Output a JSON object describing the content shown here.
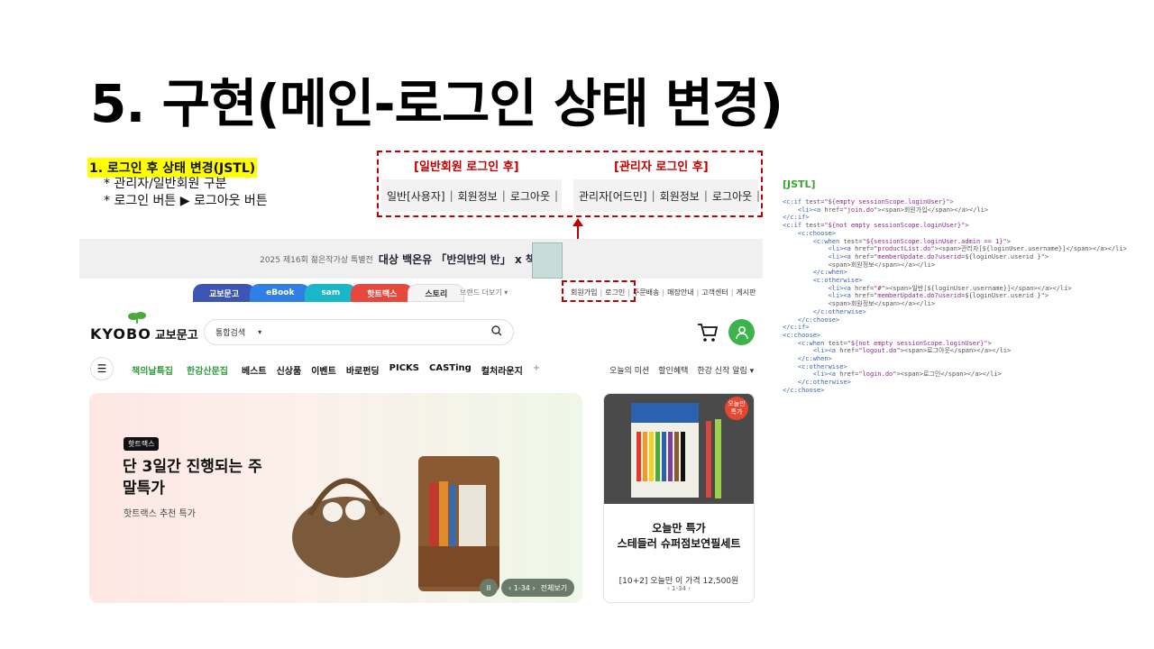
{
  "slide": {
    "title": "5. 구현(메인-로그인 상태 변경)",
    "step": "1. 로그인 후 상태 변경(JSTL)",
    "bullets": [
      "* 관리자/일반회원 구분",
      "* 로그인 버튼 ▶ 로그아웃 버튼"
    ]
  },
  "states": {
    "user_label": "[일반회원 로그인 후]",
    "admin_label": "[관리자 로그인 후]",
    "user_items": [
      "일반[사용자]",
      "회원정보",
      "로그아웃"
    ],
    "admin_items": [
      "관리자[어드민]",
      "회원정보",
      "로그아웃"
    ],
    "separator": "|"
  },
  "kyobo": {
    "banner": {
      "small": "2025 제16회 젊은작가상 특별전",
      "bold": "대상 백온유 「반의반의 반」 x 책갈피"
    },
    "tabs": [
      {
        "label": "교보문고",
        "color": "#3d55b4"
      },
      {
        "label": "eBook",
        "color": "#2f7fe6"
      },
      {
        "label": "sam",
        "color": "#19b8c8"
      },
      {
        "label": "핫트랙스",
        "color": "#e8483b"
      },
      {
        "label": "스토리",
        "color": "#f4f4f4"
      }
    ],
    "brand_more": "브랜드 더보기 ▾",
    "util_nav": [
      "회원가입",
      "로그인",
      "주문배송",
      "매장안내",
      "고객센터",
      "게시판"
    ],
    "logo_word": "KYOBO",
    "logo_kr": "교보문고",
    "search": {
      "category": "통합검색",
      "dropdown": "▾",
      "icon": "search-icon"
    },
    "gnb": [
      {
        "label": "책의날특집",
        "color": "#2e9b3a",
        "dot": true
      },
      {
        "label": "한강산문집",
        "color": "#2e9b3a",
        "dot": true
      },
      {
        "label": "베스트",
        "color": "#111"
      },
      {
        "label": "신상품",
        "color": "#111"
      },
      {
        "label": "이벤트",
        "color": "#111"
      },
      {
        "label": "바로펀딩",
        "color": "#111"
      },
      {
        "label": "PICKS",
        "color": "#111"
      },
      {
        "label": "CASTing",
        "color": "#111"
      },
      {
        "label": "컬처라운지",
        "color": "#111"
      }
    ],
    "gnb_plus": "+",
    "gnb_right": [
      "오늘의 미션",
      "할인혜택",
      "한강 신작 알림 ▾"
    ],
    "hero": {
      "badge": "핫트랙스",
      "title": "단 3일간 진행되는 주말특가",
      "sub": "핫트랙스 추천 특가",
      "pause": "II",
      "pager": "‹  1-34  ›",
      "all": "전체보기"
    },
    "side": {
      "badge": "오늘만 특가",
      "t1": "오늘만 특가",
      "t2": "스테들러 슈퍼점보연필세트",
      "price": "[10+2] 오늘만 이 가격 12,500원",
      "pager": "‹   1-34   ›"
    }
  },
  "jstl": {
    "title": "[JSTL]"
  }
}
